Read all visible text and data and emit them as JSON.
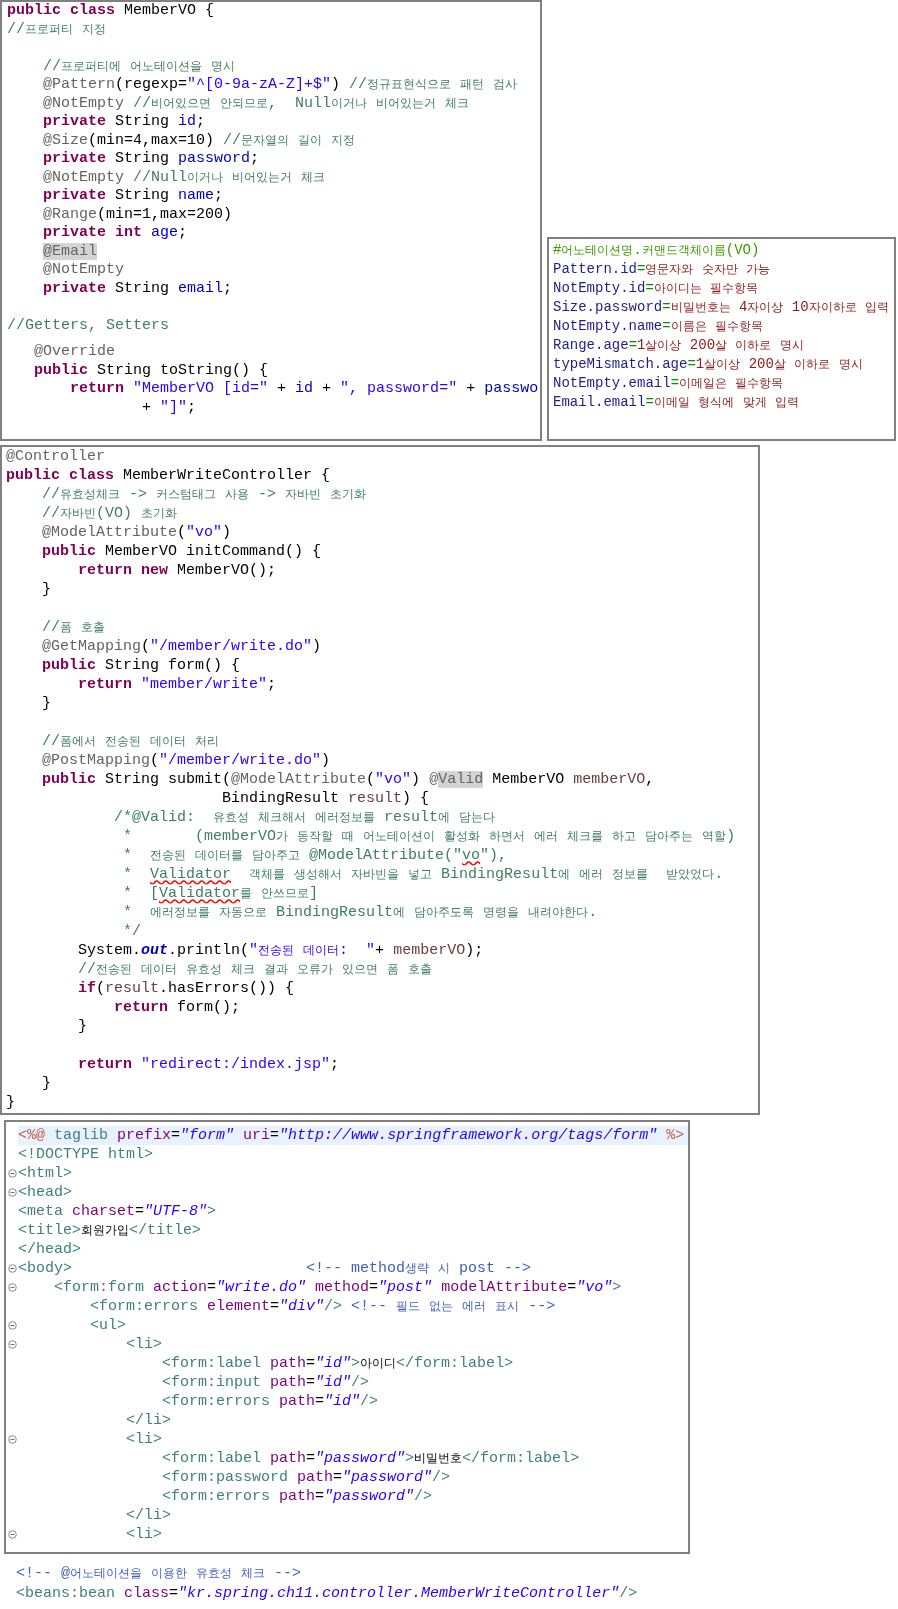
{
  "member_vo_panel": {
    "snippets": [
      {
        "lines": [
          {
            "tokens": [
              {
                "kind": "kw",
                "text": "public class"
              },
              {
                "kind": "plain",
                "text": " MemberVO {"
              }
            ]
          },
          {
            "tokens": [
              {
                "kind": "comment",
                "text": "//프로퍼티 지정"
              }
            ]
          },
          {
            "kind": "blank"
          },
          {
            "tokens": [
              {
                "kind": "comment",
                "text": "    //프로퍼티에 어노테이션을 명시"
              }
            ]
          },
          {
            "tokens": [
              {
                "kind": "ann",
                "text": "    @Pattern"
              },
              {
                "kind": "plain",
                "text": "(regexp="
              },
              {
                "kind": "str",
                "text": "\"^[0-9a-zA-Z]+$\""
              },
              {
                "kind": "plain",
                "text": ") "
              },
              {
                "kind": "comment",
                "text": "//정규표현식으로 패턴 검사"
              }
            ]
          },
          {
            "tokens": [
              {
                "kind": "ann",
                "text": "    @NotEmpty "
              },
              {
                "kind": "comment",
                "text": "//비어있으면 안되므로,  Null이거나 비어있는거 체크"
              }
            ]
          },
          {
            "tokens": [
              {
                "kind": "kw",
                "text": "    private"
              },
              {
                "kind": "plain",
                "text": " String "
              },
              {
                "kind": "field",
                "text": "id"
              },
              {
                "kind": "plain",
                "text": ";"
              }
            ]
          },
          {
            "tokens": [
              {
                "kind": "ann",
                "text": "    @Size"
              },
              {
                "kind": "plain",
                "text": "(min=4,max=10) "
              },
              {
                "kind": "comment",
                "text": "//문자열의 길이 지정"
              }
            ]
          },
          {
            "tokens": [
              {
                "kind": "kw",
                "text": "    private"
              },
              {
                "kind": "plain",
                "text": " String "
              },
              {
                "kind": "field",
                "text": "password"
              },
              {
                "kind": "plain",
                "text": ";"
              }
            ]
          },
          {
            "tokens": [
              {
                "kind": "ann",
                "text": "    @NotEmpty "
              },
              {
                "kind": "comment",
                "text": "//Null이거나 비어있는거 체크"
              }
            ]
          },
          {
            "tokens": [
              {
                "kind": "kw",
                "text": "    private"
              },
              {
                "kind": "plain",
                "text": " String "
              },
              {
                "kind": "field",
                "text": "name"
              },
              {
                "kind": "plain",
                "text": ";"
              }
            ]
          },
          {
            "tokens": [
              {
                "kind": "ann",
                "text": "    @Range"
              },
              {
                "kind": "plain",
                "text": "(min=1,max=200)"
              }
            ]
          },
          {
            "tokens": [
              {
                "kind": "kw",
                "text": "    private int"
              },
              {
                "kind": "field",
                "text": " age"
              },
              {
                "kind": "plain",
                "text": ";"
              }
            ]
          },
          {
            "indented": true,
            "tokens": [
              {
                "kind": "ann",
                "text": "@Email",
                "highlighted": true
              }
            ]
          },
          {
            "tokens": [
              {
                "kind": "ann",
                "text": "    @NotEmpty"
              }
            ]
          },
          {
            "tokens": [
              {
                "kind": "kw",
                "text": "    private"
              },
              {
                "kind": "plain",
                "text": " String "
              },
              {
                "kind": "field",
                "text": "email"
              },
              {
                "kind": "plain",
                "text": ";"
              }
            ]
          },
          {
            "kind": "blank"
          },
          {
            "tokens": [
              {
                "kind": "comment",
                "text": "//Getters, Setters"
              }
            ]
          }
        ]
      },
      {
        "lines": [
          {
            "tokens": [
              {
                "kind": "ann",
                "text": "   @Override"
              }
            ]
          },
          {
            "tokens": [
              {
                "kind": "kw",
                "text": "   public"
              },
              {
                "kind": "plain",
                "text": " String toString() {"
              }
            ]
          },
          {
            "tokens": [
              {
                "kind": "kw",
                "text": "       return"
              },
              {
                "kind": "str",
                "text": " \"MemberVO [id=\""
              },
              {
                "kind": "plain",
                "text": " + "
              },
              {
                "kind": "field",
                "text": "id"
              },
              {
                "kind": "plain",
                "text": " + "
              },
              {
                "kind": "str",
                "text": "\", password=\""
              },
              {
                "kind": "plain",
                "text": " + "
              },
              {
                "kind": "field",
                "text": "passwo"
              }
            ]
          },
          {
            "tokens": [
              {
                "kind": "plain",
                "text": "               + "
              },
              {
                "kind": "str",
                "text": "\"]\""
              },
              {
                "kind": "plain",
                "text": ";"
              }
            ]
          }
        ]
      }
    ]
  },
  "messages_panel": {
    "lines": [
      {
        "tokens": [
          {
            "kind": "pcomment",
            "text": "#어노테이션명.커맨드객체이름(VO)"
          }
        ]
      },
      {
        "tokens": [
          {
            "kind": "pkey",
            "text": "Pattern.id"
          },
          {
            "kind": "peq",
            "text": "="
          },
          {
            "kind": "pval",
            "text": "영문자와 숫자만 가능"
          }
        ]
      },
      {
        "tokens": [
          {
            "kind": "pkey",
            "text": "NotEmpty.id"
          },
          {
            "kind": "peq",
            "text": "="
          },
          {
            "kind": "pval",
            "text": "아이디는 필수항목"
          }
        ]
      },
      {
        "tokens": [
          {
            "kind": "pkey",
            "text": "Size.password"
          },
          {
            "kind": "peq",
            "text": "="
          },
          {
            "kind": "pval",
            "text": "비밀번호는 4자이상 10자이하로 입력"
          }
        ]
      },
      {
        "tokens": [
          {
            "kind": "pkey",
            "text": "NotEmpty.name"
          },
          {
            "kind": "peq",
            "text": "="
          },
          {
            "kind": "pval",
            "text": "이름은 필수항목"
          }
        ]
      },
      {
        "tokens": [
          {
            "kind": "pkey",
            "text": "Range.age"
          },
          {
            "kind": "peq",
            "text": "="
          },
          {
            "kind": "pval",
            "text": "1살이상 200살 이하로 명시"
          }
        ]
      },
      {
        "tokens": [
          {
            "kind": "pkey",
            "text": "typeMismatch.age"
          },
          {
            "kind": "peq",
            "text": "="
          },
          {
            "kind": "pval",
            "text": "1살이상 200살 이하로 명시"
          }
        ]
      },
      {
        "tokens": [
          {
            "kind": "pkey",
            "text": "NotEmpty.email"
          },
          {
            "kind": "peq",
            "text": "="
          },
          {
            "kind": "pval",
            "text": "이메일은 필수항목"
          }
        ]
      },
      {
        "tokens": [
          {
            "kind": "pkey",
            "text": "Email.email"
          },
          {
            "kind": "peq",
            "text": "="
          },
          {
            "kind": "pval",
            "text": "이메일 형식에 맞게 입력"
          }
        ]
      }
    ]
  },
  "controller_panel": {
    "lines": [
      {
        "tokens": [
          {
            "kind": "ann",
            "text": "@Controller"
          }
        ]
      },
      {
        "tokens": [
          {
            "kind": "kw",
            "text": "public class"
          },
          {
            "kind": "plain",
            "text": " MemberWriteController {"
          }
        ]
      },
      {
        "tokens": [
          {
            "kind": "comment",
            "text": "    //유효성체크 -> 커스텀태그 사용 -> 자바빈 초기화"
          }
        ]
      },
      {
        "tokens": [
          {
            "kind": "comment",
            "text": "    //자바빈(VO) 초기화"
          }
        ]
      },
      {
        "tokens": [
          {
            "kind": "ann",
            "text": "    @ModelAttribute"
          },
          {
            "kind": "plain",
            "text": "("
          },
          {
            "kind": "str",
            "text": "\"vo\""
          },
          {
            "kind": "plain",
            "text": ")"
          }
        ]
      },
      {
        "tokens": [
          {
            "kind": "kw",
            "text": "    public"
          },
          {
            "kind": "plain",
            "text": " MemberVO initCommand() {"
          }
        ]
      },
      {
        "tokens": [
          {
            "kind": "kw",
            "text": "        return new"
          },
          {
            "kind": "plain",
            "text": " MemberVO();"
          }
        ]
      },
      {
        "tokens": [
          {
            "kind": "plain",
            "text": "    }"
          }
        ]
      },
      {
        "kind": "blank"
      },
      {
        "tokens": [
          {
            "kind": "comment",
            "text": "    //폼 호출"
          }
        ]
      },
      {
        "tokens": [
          {
            "kind": "ann",
            "text": "    @GetMapping"
          },
          {
            "kind": "plain",
            "text": "("
          },
          {
            "kind": "str",
            "text": "\"/member/write.do\""
          },
          {
            "kind": "plain",
            "text": ")"
          }
        ]
      },
      {
        "tokens": [
          {
            "kind": "kw",
            "text": "    public"
          },
          {
            "kind": "plain",
            "text": " String form() {"
          }
        ]
      },
      {
        "tokens": [
          {
            "kind": "kw",
            "text": "        return"
          },
          {
            "kind": "str",
            "text": " \"member/write\""
          },
          {
            "kind": "plain",
            "text": ";"
          }
        ]
      },
      {
        "tokens": [
          {
            "kind": "plain",
            "text": "    }"
          }
        ]
      },
      {
        "kind": "blank"
      },
      {
        "tokens": [
          {
            "kind": "comment",
            "text": "    //폼에서 전송된 데이터 처리"
          }
        ]
      },
      {
        "tokens": [
          {
            "kind": "ann",
            "text": "    @PostMapping"
          },
          {
            "kind": "plain",
            "text": "("
          },
          {
            "kind": "str",
            "text": "\"/member/write.do\""
          },
          {
            "kind": "plain",
            "text": ")"
          }
        ]
      },
      {
        "tokens": [
          {
            "kind": "kw",
            "text": "    public"
          },
          {
            "kind": "plain",
            "text": " String submit("
          },
          {
            "kind": "ann",
            "text": "@ModelAttribute"
          },
          {
            "kind": "plain",
            "text": "("
          },
          {
            "kind": "str",
            "text": "\"vo\""
          },
          {
            "kind": "plain",
            "text": ") "
          },
          {
            "kind": "ann",
            "text": "@"
          },
          {
            "kind": "ann",
            "text": "Valid",
            "highlighted": true
          },
          {
            "kind": "plain",
            "text": " MemberVO "
          },
          {
            "kind": "var",
            "text": "memberVO"
          },
          {
            "kind": "plain",
            "text": ","
          }
        ]
      },
      {
        "tokens": [
          {
            "kind": "plain",
            "text": "                        BindingResult "
          },
          {
            "kind": "var",
            "text": "result"
          },
          {
            "kind": "plain",
            "text": ") {"
          }
        ]
      },
      {
        "tokens": [
          {
            "kind": "comment",
            "text": "            /*@Valid:  유효성 체크해서 에러정보를 result에 담는다"
          }
        ]
      },
      {
        "tokens": [
          {
            "kind": "comment",
            "text": "             *       (memberVO가 동작할 때 어노테이션이 활성화 하면서 에러 체크를 하고 담아주는 역할)"
          }
        ]
      },
      {
        "tokens": [
          {
            "kind": "comment",
            "text": "             *  전송된 데이터를 담아주고 @ModelAttribute(\""
          },
          {
            "kind": "comment",
            "text": "vo",
            "misspelled": true
          },
          {
            "kind": "comment",
            "text": "\"),"
          }
        ]
      },
      {
        "tokens": [
          {
            "kind": "comment",
            "text": "             *  "
          },
          {
            "kind": "comment",
            "text": "Validator",
            "misspelled": true
          },
          {
            "kind": "comment",
            "text": "  객체를 생성해서 자바빈을 넣고 BindingResult에 에러 정보를  받았었다."
          }
        ]
      },
      {
        "tokens": [
          {
            "kind": "comment",
            "text": "             *  ["
          },
          {
            "kind": "comment",
            "text": "Validator",
            "misspelled": true
          },
          {
            "kind": "comment",
            "text": "를 안쓰므로]"
          }
        ]
      },
      {
        "tokens": [
          {
            "kind": "comment",
            "text": "             *  에러정보를 자동으로 BindingResult에 담아주도록 명령을 내려야한다."
          }
        ]
      },
      {
        "tokens": [
          {
            "kind": "comment",
            "text": "             */"
          }
        ]
      },
      {
        "tokens": [
          {
            "kind": "plain",
            "text": "        System."
          },
          {
            "kind": "sfield",
            "text": "out"
          },
          {
            "kind": "plain",
            "text": ".println("
          },
          {
            "kind": "str",
            "text": "\"전송된 데이터:  \""
          },
          {
            "kind": "plain",
            "text": "+ "
          },
          {
            "kind": "var",
            "text": "memberVO"
          },
          {
            "kind": "plain",
            "text": ");"
          }
        ]
      },
      {
        "tokens": [
          {
            "kind": "comment",
            "text": "        //전송된 데이터 유효성 체크 결과 오류가 있으면 폼 호출"
          }
        ]
      },
      {
        "tokens": [
          {
            "kind": "kw",
            "text": "        if"
          },
          {
            "kind": "plain",
            "text": "("
          },
          {
            "kind": "var",
            "text": "result"
          },
          {
            "kind": "plain",
            "text": ".hasErrors()) {"
          }
        ]
      },
      {
        "tokens": [
          {
            "kind": "kw",
            "text": "            return"
          },
          {
            "kind": "plain",
            "text": " form();"
          }
        ]
      },
      {
        "tokens": [
          {
            "kind": "plain",
            "text": "        }"
          }
        ]
      },
      {
        "kind": "blank"
      },
      {
        "tokens": [
          {
            "kind": "kw",
            "text": "        return"
          },
          {
            "kind": "str",
            "text": " \"redirect:/index.jsp\""
          },
          {
            "kind": "plain",
            "text": ";"
          }
        ]
      },
      {
        "tokens": [
          {
            "kind": "plain",
            "text": "    }"
          }
        ]
      },
      {
        "tokens": [
          {
            "kind": "plain",
            "text": "}"
          }
        ]
      }
    ]
  },
  "jsp_panel": {
    "lines": [
      {
        "fold": false,
        "current": true,
        "tokens": [
          {
            "kind": "jsp",
            "text": "<%@"
          },
          {
            "kind": "tag",
            "text": " taglib "
          },
          {
            "kind": "attr",
            "text": "prefix"
          },
          {
            "kind": "plain",
            "text": "="
          },
          {
            "kind": "aval",
            "text": "\"form\""
          },
          {
            "kind": "attr",
            "text": " uri"
          },
          {
            "kind": "plain",
            "text": "="
          },
          {
            "kind": "aval",
            "text": "\"http://www.springframework.org/tags/form\""
          },
          {
            "kind": "jsp",
            "text": " %>"
          }
        ]
      },
      {
        "fold": false,
        "current": false,
        "tokens": [
          {
            "kind": "tag",
            "text": "<!DOCTYPE html>"
          }
        ]
      },
      {
        "fold": true,
        "current": false,
        "tokens": [
          {
            "kind": "tag",
            "text": "<html>"
          }
        ]
      },
      {
        "fold": true,
        "current": false,
        "tokens": [
          {
            "kind": "tag",
            "text": "<head>"
          }
        ]
      },
      {
        "fold": false,
        "current": false,
        "tokens": [
          {
            "kind": "tag",
            "text": "<meta"
          },
          {
            "kind": "attr",
            "text": " charset"
          },
          {
            "kind": "plain",
            "text": "="
          },
          {
            "kind": "aval",
            "text": "\"UTF-8\""
          },
          {
            "kind": "tag",
            "text": ">"
          }
        ]
      },
      {
        "fold": false,
        "current": false,
        "tokens": [
          {
            "kind": "tag",
            "text": "<title>"
          },
          {
            "kind": "plain",
            "text": "회원가입"
          },
          {
            "kind": "tag",
            "text": "</title>"
          }
        ]
      },
      {
        "fold": false,
        "current": false,
        "tokens": [
          {
            "kind": "tag",
            "text": "</head>"
          }
        ]
      },
      {
        "fold": true,
        "current": false,
        "tokens": [
          {
            "kind": "tag",
            "text": "<body>"
          },
          {
            "kind": "hcomment",
            "text": "                          <!-- method생략 시 post -->"
          }
        ]
      },
      {
        "fold": true,
        "current": false,
        "tokens": [
          {
            "kind": "tag",
            "text": "    <form:form"
          },
          {
            "kind": "attr",
            "text": " action"
          },
          {
            "kind": "plain",
            "text": "="
          },
          {
            "kind": "aval",
            "text": "\"write.do\""
          },
          {
            "kind": "attr",
            "text": " method"
          },
          {
            "kind": "plain",
            "text": "="
          },
          {
            "kind": "aval",
            "text": "\"post\""
          },
          {
            "kind": "attr",
            "text": " modelAttribute"
          },
          {
            "kind": "plain",
            "text": "="
          },
          {
            "kind": "aval",
            "text": "\"vo\""
          },
          {
            "kind": "tag",
            "text": ">"
          }
        ]
      },
      {
        "fold": false,
        "current": false,
        "tokens": [
          {
            "kind": "tag",
            "text": "        <form:errors"
          },
          {
            "kind": "attr",
            "text": " element"
          },
          {
            "kind": "plain",
            "text": "="
          },
          {
            "kind": "aval",
            "text": "\"div\""
          },
          {
            "kind": "tag",
            "text": "/>"
          },
          {
            "kind": "hcomment",
            "text": " <!-- 필드 없는 에러 표시 -->"
          }
        ]
      },
      {
        "fold": true,
        "current": false,
        "tokens": [
          {
            "kind": "tag",
            "text": "        <ul>"
          }
        ]
      },
      {
        "fold": true,
        "current": false,
        "tokens": [
          {
            "kind": "tag",
            "text": "            <li>"
          }
        ]
      },
      {
        "fold": false,
        "current": false,
        "tokens": [
          {
            "kind": "tag",
            "text": "                <form:label"
          },
          {
            "kind": "attr",
            "text": " path"
          },
          {
            "kind": "plain",
            "text": "="
          },
          {
            "kind": "aval",
            "text": "\"id\""
          },
          {
            "kind": "tag",
            "text": ">"
          },
          {
            "kind": "plain",
            "text": "아이디"
          },
          {
            "kind": "tag",
            "text": "</form:label>"
          }
        ]
      },
      {
        "fold": false,
        "current": false,
        "tokens": [
          {
            "kind": "tag",
            "text": "                <form:input"
          },
          {
            "kind": "attr",
            "text": " path"
          },
          {
            "kind": "plain",
            "text": "="
          },
          {
            "kind": "aval",
            "text": "\"id\""
          },
          {
            "kind": "tag",
            "text": "/>"
          }
        ]
      },
      {
        "fold": false,
        "current": false,
        "tokens": [
          {
            "kind": "tag",
            "text": "                <form:errors"
          },
          {
            "kind": "attr",
            "text": " path"
          },
          {
            "kind": "plain",
            "text": "="
          },
          {
            "kind": "aval",
            "text": "\"id\""
          },
          {
            "kind": "tag",
            "text": "/>"
          }
        ]
      },
      {
        "fold": false,
        "current": false,
        "tokens": [
          {
            "kind": "tag",
            "text": "            </li>"
          }
        ]
      },
      {
        "fold": true,
        "current": false,
        "tokens": [
          {
            "kind": "tag",
            "text": "            <li>"
          }
        ]
      },
      {
        "fold": false,
        "current": false,
        "tokens": [
          {
            "kind": "tag",
            "text": "                <form:label"
          },
          {
            "kind": "attr",
            "text": " path"
          },
          {
            "kind": "plain",
            "text": "="
          },
          {
            "kind": "aval",
            "text": "\"password\""
          },
          {
            "kind": "tag",
            "text": ">"
          },
          {
            "kind": "plain",
            "text": "비밀번호"
          },
          {
            "kind": "tag",
            "text": "</form:label>"
          }
        ]
      },
      {
        "fold": false,
        "current": false,
        "tokens": [
          {
            "kind": "tag",
            "text": "                <form:password"
          },
          {
            "kind": "attr",
            "text": " path"
          },
          {
            "kind": "plain",
            "text": "="
          },
          {
            "kind": "aval",
            "text": "\"password\""
          },
          {
            "kind": "tag",
            "text": "/>"
          }
        ]
      },
      {
        "fold": false,
        "current": false,
        "tokens": [
          {
            "kind": "tag",
            "text": "                <form:errors"
          },
          {
            "kind": "attr",
            "text": " path"
          },
          {
            "kind": "plain",
            "text": "="
          },
          {
            "kind": "aval",
            "text": "\"password\""
          },
          {
            "kind": "tag",
            "text": "/>"
          }
        ]
      },
      {
        "fold": false,
        "current": false,
        "tokens": [
          {
            "kind": "tag",
            "text": "            </li>"
          }
        ]
      },
      {
        "fold": true,
        "current": false,
        "tokens": [
          {
            "kind": "tag",
            "text": "            <li>"
          }
        ]
      }
    ]
  },
  "loose_lines": [
    {
      "tokens": [
        {
          "kind": "hcomment",
          "text": "<!-- @어노테이션을 이용한 유효성 체크 -->"
        }
      ]
    },
    {
      "tokens": [
        {
          "kind": "tag",
          "text": "<beans:bean"
        },
        {
          "kind": "attr",
          "text": " class"
        },
        {
          "kind": "plain",
          "text": "="
        },
        {
          "kind": "aval",
          "text": "\"kr.spring.ch11.controller.MemberWriteController\""
        },
        {
          "kind": "tag",
          "text": "/>"
        }
      ]
    }
  ]
}
